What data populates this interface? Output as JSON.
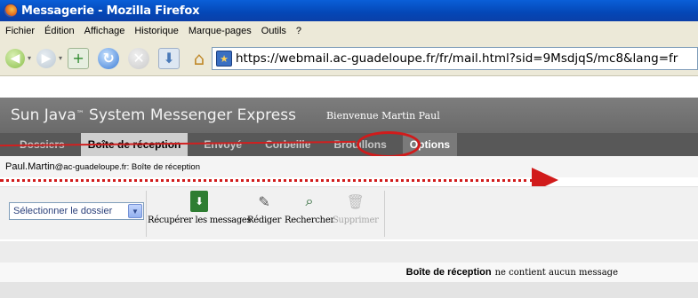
{
  "window": {
    "title": "Messagerie - Mozilla Firefox"
  },
  "menu": {
    "items": [
      {
        "label": "Fichier"
      },
      {
        "label": "Édition"
      },
      {
        "label": "Affichage"
      },
      {
        "label": "Historique"
      },
      {
        "label": "Marque-pages"
      },
      {
        "label": "Outils"
      },
      {
        "label": "?"
      }
    ]
  },
  "navbar": {
    "url": "https://webmail.ac-guadeloupe.fr/fr/mail.html?sid=9MsdjqS/mc8&lang=fr",
    "icons": [
      "back-icon",
      "forward-icon",
      "new-tab-icon",
      "reload-icon",
      "stop-icon",
      "bookmark-icon",
      "home-icon",
      "site-icon"
    ]
  },
  "app": {
    "name": "Sun Java",
    "name_sup": "™",
    "name_rest": " System Messenger Express",
    "welcome": "Bienvenue Martin  Paul"
  },
  "tabs": [
    {
      "label": "Dossiers"
    },
    {
      "label": "Boîte de réception"
    },
    {
      "label": "Envoyé"
    },
    {
      "label": "Corbeille"
    },
    {
      "label": "Brouillons"
    },
    {
      "label": "Options"
    }
  ],
  "breadcrumb": {
    "user": "Paul.Martin",
    "rest": "@ac-guadeloupe.fr: Boîte de réception"
  },
  "toolbar": {
    "folder_select": "Sélectionner le dossier",
    "get_messages": "Récupérer les messages",
    "compose": "Rédiger",
    "search": "Rechercher",
    "delete": "Supprimer"
  },
  "status": {
    "folder": "Boîte de réception",
    "message": "ne contient aucun message"
  },
  "colors": {
    "annotation_red": "#d11b1b",
    "header_gray": "#6a6a6a",
    "tabbar_gray": "#585858"
  }
}
